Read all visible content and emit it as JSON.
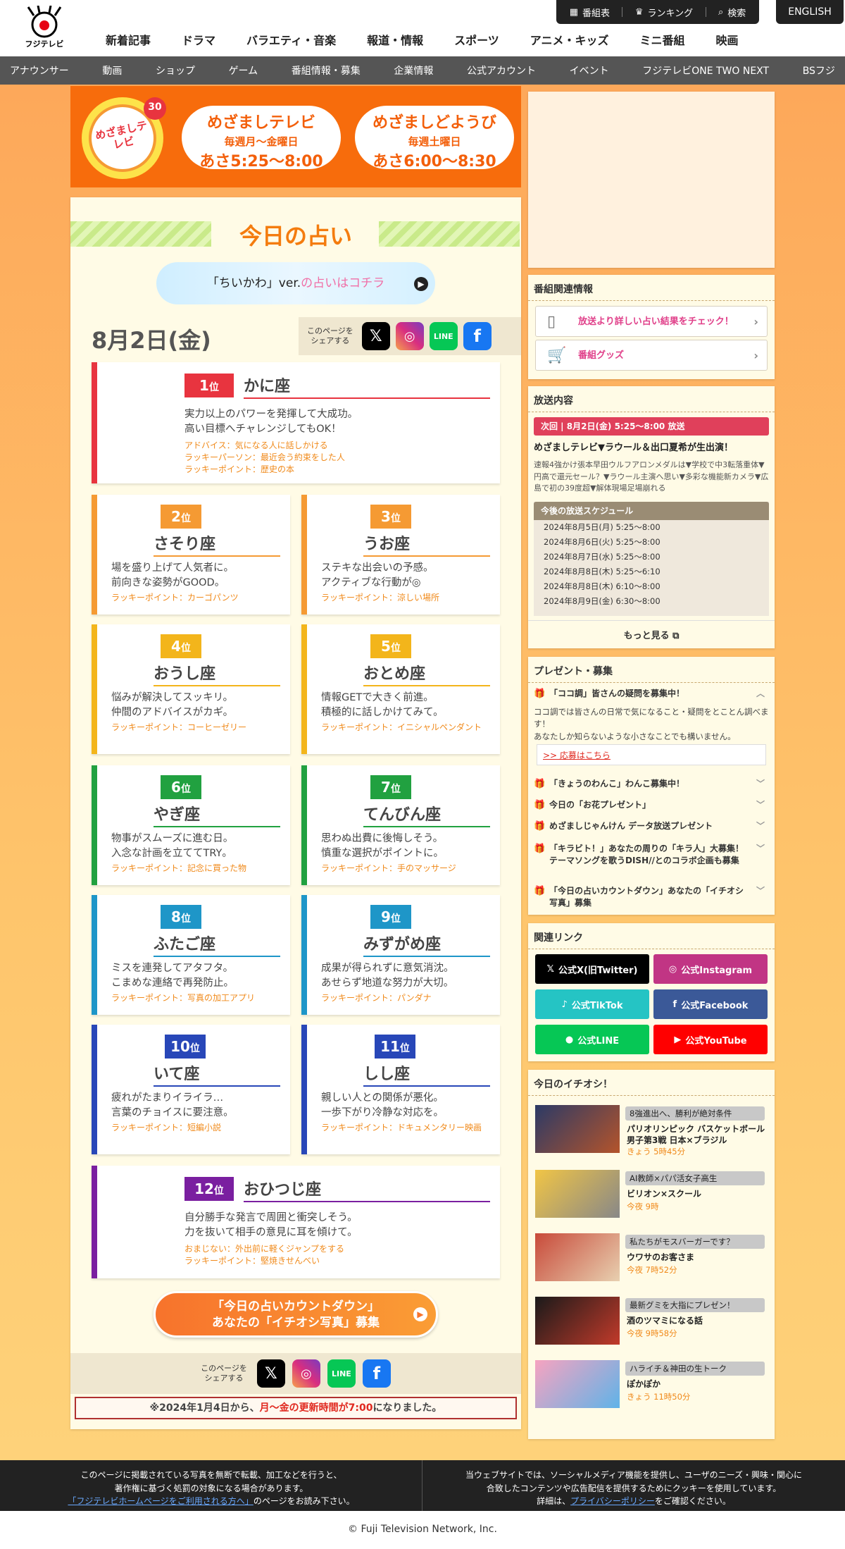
{
  "header": {
    "logo_text": "フジテレビ",
    "util": [
      "番組表",
      "ランキング",
      "検索"
    ],
    "english": "ENGLISH",
    "gnav": [
      "新着記事",
      "ドラマ",
      "バラエティ・音楽",
      "報道・情報",
      "スポーツ",
      "アニメ・キッズ",
      "ミニ番組",
      "映画"
    ],
    "snav": [
      "アナウンサー",
      "動画",
      "ショップ",
      "ゲーム",
      "番組情報・募集",
      "企業情報",
      "公式アカウント",
      "イベント",
      "フジテレビONE TWO NEXT",
      "BSフジ"
    ]
  },
  "banner": {
    "logo_text": "めざましテレビ",
    "logo_badge": "30",
    "weekday": {
      "title": "めざましテレビ",
      "days": "毎週月〜金曜日",
      "time": "あさ5:25〜8:00"
    },
    "saturday": {
      "title": "めざましどようび",
      "days": "毎週土曜日",
      "time": "あさ6:00〜8:30"
    }
  },
  "main": {
    "title": "今日の占い",
    "chiikawa_a": "「ちいかわ」ver.",
    "chiikawa_b": "の占いはコチラ",
    "date": "8月2日(金)",
    "share_label": "このページを\nシェアする",
    "countdown_l1": "「今日の占いカウントダウン」",
    "countdown_l2": "あなたの「イチオシ写真」募集",
    "notice_a": "※2024年1月4日から、",
    "notice_b": "月〜金の更新時間が7:00",
    "notice_c": "になりました。"
  },
  "fortunes": [
    {
      "rank": "1",
      "sign": "かに座",
      "color": "#e8343f",
      "l1": "実力以上のパワーを発揮して大成功。",
      "l2": "高い目標へチャレンジしてもOK！",
      "extra": [
        "アドバイス：気になる人に話しかける",
        "ラッキーパーソン：最近会う約束をした人",
        "ラッキーポイント：歴史の本"
      ]
    },
    {
      "rank": "2",
      "sign": "さそり座",
      "color": "#f59a33",
      "l1": "場を盛り上げて人気者に。",
      "l2": "前向きな姿勢がGOOD。",
      "extra": [
        "ラッキーポイント：カーゴパンツ"
      ]
    },
    {
      "rank": "3",
      "sign": "うお座",
      "color": "#f59a33",
      "l1": "ステキな出会いの予感。",
      "l2": "アクティブな行動が◎",
      "extra": [
        "ラッキーポイント：涼しい場所"
      ]
    },
    {
      "rank": "4",
      "sign": "おうし座",
      "color": "#f3b51b",
      "l1": "悩みが解決してスッキリ。",
      "l2": "仲間のアドバイスがカギ。",
      "extra": [
        "ラッキーポイント：コーヒーゼリー"
      ]
    },
    {
      "rank": "5",
      "sign": "おとめ座",
      "color": "#f3b51b",
      "l1": "情報GETで大きく前進。",
      "l2": "積極的に話しかけてみて。",
      "extra": [
        "ラッキーポイント：イニシャルペンダント"
      ]
    },
    {
      "rank": "6",
      "sign": "やぎ座",
      "color": "#21a140",
      "l1": "物事がスムーズに進む日。",
      "l2": "入念な計画を立ててTRY。",
      "extra": [
        "ラッキーポイント：記念に買った物"
      ]
    },
    {
      "rank": "7",
      "sign": "てんびん座",
      "color": "#21a140",
      "l1": "思わぬ出費に後悔しそう。",
      "l2": "慎重な選択がポイントに。",
      "extra": [
        "ラッキーポイント：手のマッサージ"
      ]
    },
    {
      "rank": "8",
      "sign": "ふたご座",
      "color": "#1e96c8",
      "l1": "ミスを連発してアタフタ。",
      "l2": "こまめな連絡で再発防止。",
      "extra": [
        "ラッキーポイント：写真の加工アプリ"
      ]
    },
    {
      "rank": "9",
      "sign": "みずがめ座",
      "color": "#1e96c8",
      "l1": "成果が得られずに意気消沈。",
      "l2": "あせらず地道な努力が大切。",
      "extra": [
        "ラッキーポイント：パンダナ"
      ]
    },
    {
      "rank": "10",
      "sign": "いて座",
      "color": "#2847b8",
      "l1": "疲れがたまりイライラ…",
      "l2": "言葉のチョイスに要注意。",
      "extra": [
        "ラッキーポイント：短編小説"
      ]
    },
    {
      "rank": "11",
      "sign": "しし座",
      "color": "#2847b8",
      "l1": "親しい人との関係が悪化。",
      "l2": "一歩下がり冷静な対応を。",
      "extra": [
        "ラッキーポイント：ドキュメンタリー映画"
      ]
    },
    {
      "rank": "12",
      "sign": "おひつじ座",
      "color": "#7a1fa0",
      "l1": "自分勝手な発言で周囲と衝突しそう。",
      "l2": "力を抜いて相手の意見に耳を傾けて。",
      "extra": [
        "おまじない：外出前に軽くジャンプをする",
        "ラッキーポイント：堅焼きせんべい"
      ]
    }
  ],
  "rank_suffix": "位",
  "sidebar": {
    "related_title": "番組関連情報",
    "related": [
      "放送より詳しい占い結果をチェック！",
      "番組グッズ"
    ],
    "broadcast_title": "放送内容",
    "next": "次回 | 8月2日(金) 5:25〜8:00 放送",
    "bc_title": "めざましテレビ▼ラウール＆出口夏希が生出演！",
    "bc_body": "速報4強かけ張本早田ウルフアロンメダルは▼学校で中3転落重体▼円高で還元セール？▼ラウール主演へ思い▼多彩な機能新カメラ▼広島で初の39度超▼解体現場足場崩れる",
    "sched_title": "今後の放送スケジュール",
    "schedule": [
      "2024年8月5日(月) 5:25〜8:00",
      "2024年8月6日(火) 5:25〜8:00",
      "2024年8月7日(水) 5:25〜8:00",
      "2024年8月8日(木) 5:25〜6:10",
      "2024年8月8日(木) 6:10〜8:00",
      "2024年8月9日(金) 6:30〜8:00"
    ],
    "more": "もっと見る",
    "present_title": "プレゼント・募集",
    "present_open": "「ココ調」皆さんの疑問を募集中！",
    "present_body": "ココ調では皆さんの日常で気になること・疑問をとことん調べます！\nあなたしか知らないような小さなことでも構いません。",
    "present_link": ">> 応募はこちら",
    "present_items": [
      "「きょうのわんこ」わんこ募集中！",
      "今日の「お花プレゼント」",
      "めざましじゃんけん データ放送プレゼント",
      "「キラビト！」あなたの周りの「キラ人」大募集！テーマソングを歌うDISH//とのコラボ企画も募集",
      "「今日の占いカウントダウン」あなたの「イチオシ写真」募集"
    ],
    "links_title": "関連リンク",
    "links": [
      {
        "label": "公式X(旧Twitter)",
        "color": "#000000"
      },
      {
        "label": "公式Instagram",
        "color": "#c13584"
      },
      {
        "label": "公式TikTok",
        "color": "#25c4c4"
      },
      {
        "label": "公式Facebook",
        "color": "#3b5998"
      },
      {
        "label": "公式LINE",
        "color": "#06c755"
      },
      {
        "label": "公式YouTube",
        "color": "#ff0000"
      }
    ],
    "rec_title": "今日のイチオシ！",
    "recommend": [
      {
        "tag": "8強進出へ、勝利が絶対条件",
        "title": "パリオリンピック バスケットボール 男子第3戦 日本×ブラジル",
        "time": "きょう 5時45分"
      },
      {
        "tag": "AI教師×パパ活女子高生",
        "title": "ビリオン×スクール",
        "time": "今夜 9時"
      },
      {
        "tag": "私たちがモスバーガーです？",
        "title": "ウワサのお客さま",
        "time": "今夜 7時52分"
      },
      {
        "tag": "最新グミを大指にプレゼン！",
        "title": "酒のツマミになる話",
        "time": "今夜 9時58分"
      },
      {
        "tag": "ハライチ＆神田の生トーク",
        "title": "ぽかぽか",
        "time": "きょう 11時50分"
      }
    ]
  },
  "footer": {
    "left_1": "このページに掲載されている写真を無断で転載、加工などを行うと、",
    "left_2": "著作権に基づく処罰の対象になる場合があります。",
    "left_link": "「フジテレビホームページをご利用される方へ」",
    "left_3": "のページをお読み下さい。",
    "right_1": "当ウェブサイトでは、ソーシャルメディア機能を提供し、ユーザのニーズ・興味・関心に",
    "right_2": "合致したコンテンツや広告配信を提供するためにクッキーを使用しています。",
    "right_3a": "詳細は、",
    "right_link": "プライバシーポリシー",
    "right_3b": "をご確認ください。",
    "copyright": "© Fuji Television Network, Inc."
  }
}
